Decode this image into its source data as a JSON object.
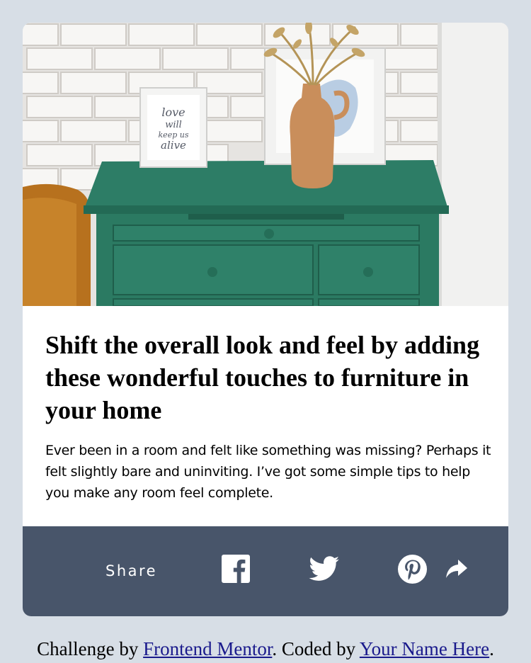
{
  "article": {
    "image_alt": "Green dresser with framed prints and a vase of dried grass against a white brick wall",
    "frame_text": "love will keep us alive",
    "headline": "Shift the overall look and feel by adding these wonderful touches to furniture in your home",
    "description": "Ever been in a room and felt like something was missing? Perhaps it felt slightly bare and uninviting. I’ve got some simple tips to help you make any room feel complete."
  },
  "share": {
    "label": "Share",
    "icons": [
      "facebook-icon",
      "twitter-icon",
      "pinterest-icon",
      "share-arrow-icon"
    ],
    "bar_color": "#48556a"
  },
  "footer": {
    "prefix": "Challenge by ",
    "link1": "Frontend Mentor",
    "middle": ". Coded by ",
    "link2": "Your Name Here",
    "suffix": "."
  },
  "colors": {
    "page_background": "#d7dee6",
    "card_background": "#ffffff",
    "link": "#1a1a8c"
  }
}
